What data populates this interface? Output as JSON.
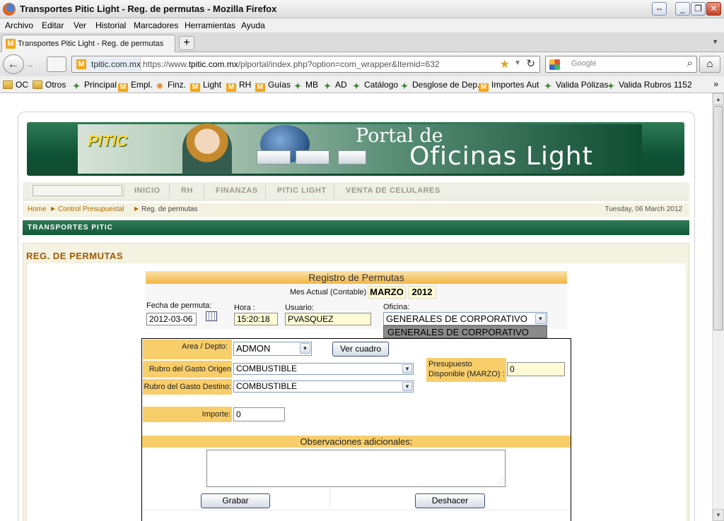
{
  "window": {
    "title": "Transportes Pitic Light - Reg. de permutas - Mozilla Firefox"
  },
  "menu": [
    "Archivo",
    "Editar",
    "Ver",
    "Historial",
    "Marcadores",
    "Herramientas",
    "Ayuda"
  ],
  "tab": {
    "label": "Transportes Pitic Light - Reg. de permutas",
    "favicon": "M"
  },
  "urlbar": {
    "site": "tpitic.com.mx",
    "url_prefix": "https://www.",
    "url_domain": "tpitic.com.mx",
    "url_rest": "/plportal/index.php?option=com_wrapper&Itemid=632"
  },
  "search": {
    "placeholder": "Google"
  },
  "bookmarks": [
    {
      "label": "OC",
      "icon": "folder-icon"
    },
    {
      "label": "Otros",
      "icon": "folder-icon"
    },
    {
      "label": "Principal",
      "icon": "runner-icon"
    },
    {
      "label": "Empl.",
      "icon": "m-icon"
    },
    {
      "label": "Finz.",
      "icon": "star-icon"
    },
    {
      "label": "Light",
      "icon": "m-icon"
    },
    {
      "label": "RH",
      "icon": "m-icon"
    },
    {
      "label": "Guías",
      "icon": "m-icon"
    },
    {
      "label": "MB",
      "icon": "runner-icon"
    },
    {
      "label": "AD",
      "icon": "runner-icon"
    },
    {
      "label": "Catálogo",
      "icon": "runner-icon"
    },
    {
      "label": "Desglose de Dep.",
      "icon": "runner-icon"
    },
    {
      "label": "Importes Aut",
      "icon": "m-icon"
    },
    {
      "label": "Valida Pólizas",
      "icon": "runner-icon"
    },
    {
      "label": "Valida Rubros 1152",
      "icon": "runner-icon"
    }
  ],
  "banner": {
    "logo": "PITIC",
    "title_line1": "Portal de",
    "title_line2": "Oficinas Light"
  },
  "nav": [
    "INICIO",
    "RH",
    "FINANZAS",
    "PITIC LIGHT",
    "VENTA DE CELULARES"
  ],
  "breadcrumb": {
    "home": "Home",
    "section": "Control Presupuestal",
    "page": "Reg. de permutas",
    "date": "Tuesday, 06 March 2012"
  },
  "company_bar": "TRANSPORTES PITIC",
  "section_title": "REG. DE PERMUTAS",
  "form": {
    "header": "Registro de Permutas",
    "mes_label": "Mes Actual (Contable)",
    "mes": "MARZO",
    "anio": "2012",
    "fecha_label": "Fecha de permuta:",
    "fecha": "2012-03-06",
    "hora_label": "Hora :",
    "hora": "15:20:18",
    "usuario_label": "Usuario:",
    "usuario": "PVASQUEZ",
    "oficina_label": "Oficina:",
    "oficina": "GENERALES DE CORPORATIVO",
    "oficina_option": "GENERALES DE CORPORATIVO",
    "area_label": "Area / Depto:",
    "area": "ADMON",
    "ver_cuadro": "Ver cuadro",
    "origen_label": "Rubro del Gasto Origen",
    "origen": "COMBUSTIBLE",
    "destino_label": "Rubro del Gasto Destino:",
    "destino": "COMBUSTIBLE",
    "presupuesto_label1": "Presupuesto",
    "presupuesto_label2": "Disponible (MARZO) :",
    "presupuesto": "0",
    "importe_label": "Importe:",
    "importe": "0",
    "obs_label": "Observaciones adicionales:",
    "grabar": "Grabar",
    "deshacer": "Deshacer"
  }
}
